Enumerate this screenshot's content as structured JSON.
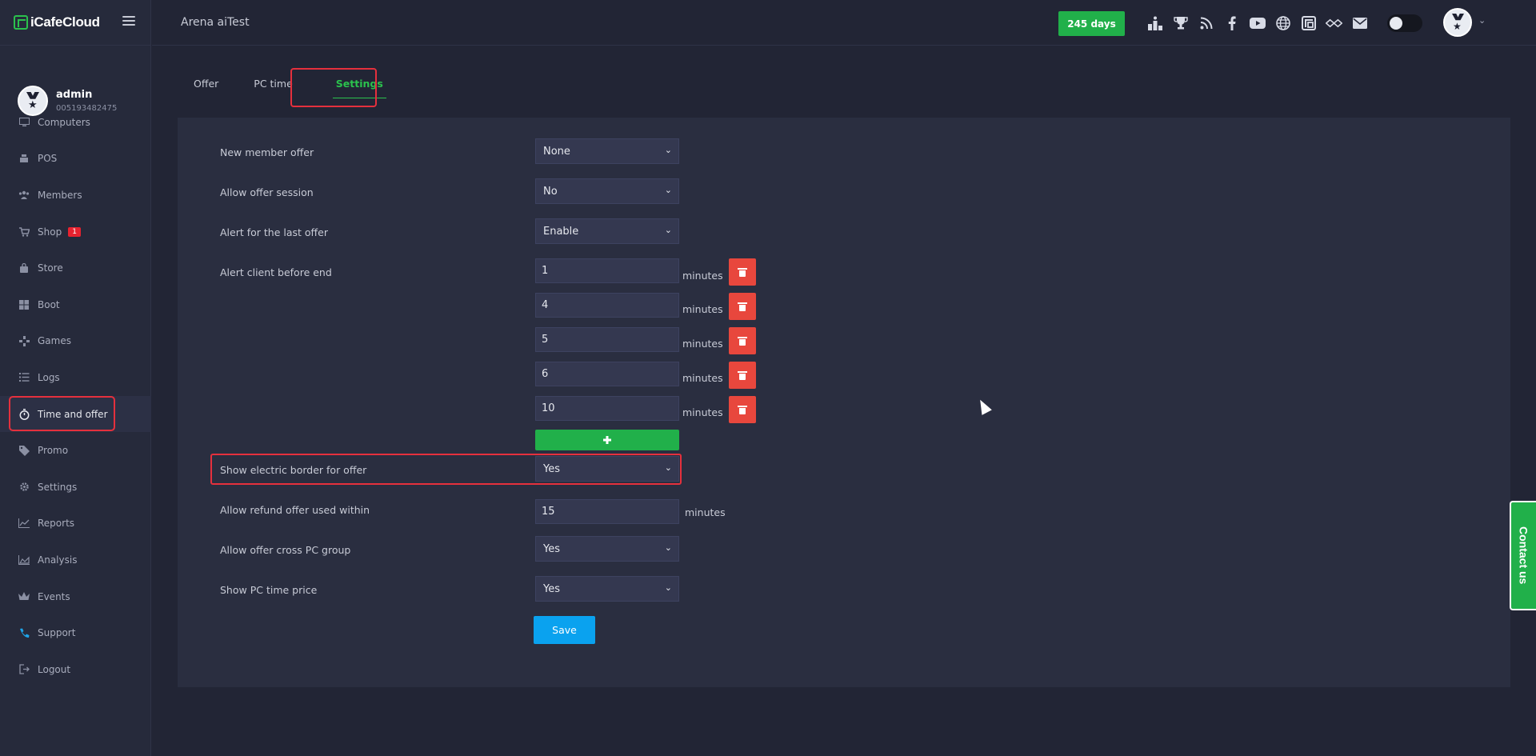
{
  "app": {
    "brand": "iCafeCloud",
    "page_title": "Arena aiTest"
  },
  "header": {
    "days_label": "245 days",
    "icons": [
      "ranking-icon",
      "trophy-icon",
      "rss-icon",
      "facebook-icon",
      "youtube-icon",
      "globe-icon",
      "icafe-icon",
      "handshake-icon",
      "mail-icon"
    ],
    "theme_toggle": "light"
  },
  "user": {
    "name": "admin",
    "id": "005193482475"
  },
  "sidebar": {
    "items": [
      {
        "key": "computers",
        "label": "Computers",
        "icon": "monitor-icon"
      },
      {
        "key": "pos",
        "label": "POS",
        "icon": "cash-register-icon"
      },
      {
        "key": "members",
        "label": "Members",
        "icon": "users-icon"
      },
      {
        "key": "shop",
        "label": "Shop",
        "icon": "cart-icon",
        "badge": "1"
      },
      {
        "key": "store",
        "label": "Store",
        "icon": "bag-icon"
      },
      {
        "key": "boot",
        "label": "Boot",
        "icon": "windows-icon"
      },
      {
        "key": "games",
        "label": "Games",
        "icon": "gamepad-icon"
      },
      {
        "key": "logs",
        "label": "Logs",
        "icon": "list-icon"
      },
      {
        "key": "time-and-offer",
        "label": "Time and offer",
        "icon": "stopwatch-icon",
        "active": true
      },
      {
        "key": "promo",
        "label": "Promo",
        "icon": "tag-icon"
      },
      {
        "key": "settings",
        "label": "Settings",
        "icon": "gear-icon"
      },
      {
        "key": "reports",
        "label": "Reports",
        "icon": "line-chart-icon"
      },
      {
        "key": "analysis",
        "label": "Analysis",
        "icon": "area-chart-icon"
      },
      {
        "key": "events",
        "label": "Events",
        "icon": "crown-icon"
      },
      {
        "key": "support",
        "label": "Support",
        "icon": "phone-icon"
      },
      {
        "key": "logout",
        "label": "Logout",
        "icon": "logout-icon"
      }
    ]
  },
  "tabs": [
    {
      "label": "Offer",
      "active": false
    },
    {
      "label": "PC time",
      "active": false
    },
    {
      "label": "Settings",
      "active": true
    }
  ],
  "settings": {
    "new_member_offer": {
      "label": "New member offer",
      "value": "None"
    },
    "allow_offer_session": {
      "label": "Allow offer session",
      "value": "No"
    },
    "alert_last_offer": {
      "label": "Alert for the last offer",
      "value": "Enable"
    },
    "alert_client_before_end": {
      "label": "Alert client before end",
      "values": [
        "1",
        "4",
        "5",
        "6",
        "10"
      ],
      "unit": "minutes"
    },
    "show_electric_border": {
      "label": "Show electric border for offer",
      "value": "Yes"
    },
    "allow_refund_within": {
      "label": "Allow refund offer used within",
      "value": "15",
      "unit": "minutes"
    },
    "allow_cross_pc_group": {
      "label": "Allow offer cross PC group",
      "value": "Yes"
    },
    "show_pc_time_price": {
      "label": "Show PC time price",
      "value": "Yes"
    },
    "save_label": "Save"
  },
  "contact_label": "Contact us",
  "colors": {
    "accent_green": "#21b04a",
    "save_blue": "#0aa2ef",
    "delete_red": "#e8473d",
    "highlight_red": "#e5303d"
  }
}
